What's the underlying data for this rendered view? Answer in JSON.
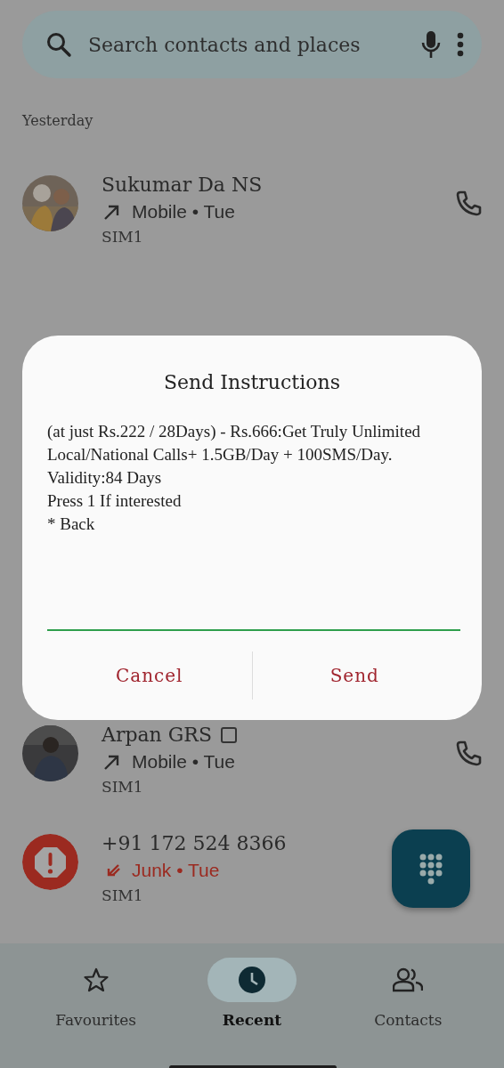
{
  "search": {
    "placeholder": "Search contacts and places"
  },
  "section_label": "Yesterday",
  "calls": [
    {
      "kind": "contact",
      "name": "Sukumar Da NS",
      "name_icon": false,
      "detail": "Mobile • Tue",
      "sim": "SIM1"
    },
    {
      "kind": "contact",
      "name": "Arpan GRS",
      "name_icon": true,
      "detail": "Mobile • Tue",
      "sim": "SIM1"
    },
    {
      "kind": "junk",
      "name": "+91 172 524 8366",
      "name_icon": false,
      "detail": "Junk • Tue",
      "sim": "SIM1"
    }
  ],
  "dialog": {
    "title": "Send Instructions",
    "message": [
      "(at just Rs.222 / 28Days) - Rs.666:Get Truly Unlimited Local/National Calls+ 1.5GB/Day + 100SMS/Day. Validity:84 Days",
      "Press 1 If interested",
      "* Back"
    ],
    "buttons": [
      "Cancel",
      "Send"
    ]
  },
  "nav": [
    {
      "label": "Favourites",
      "selected": false
    },
    {
      "label": "Recent",
      "selected": true
    },
    {
      "label": "Contacts",
      "selected": false
    }
  ]
}
